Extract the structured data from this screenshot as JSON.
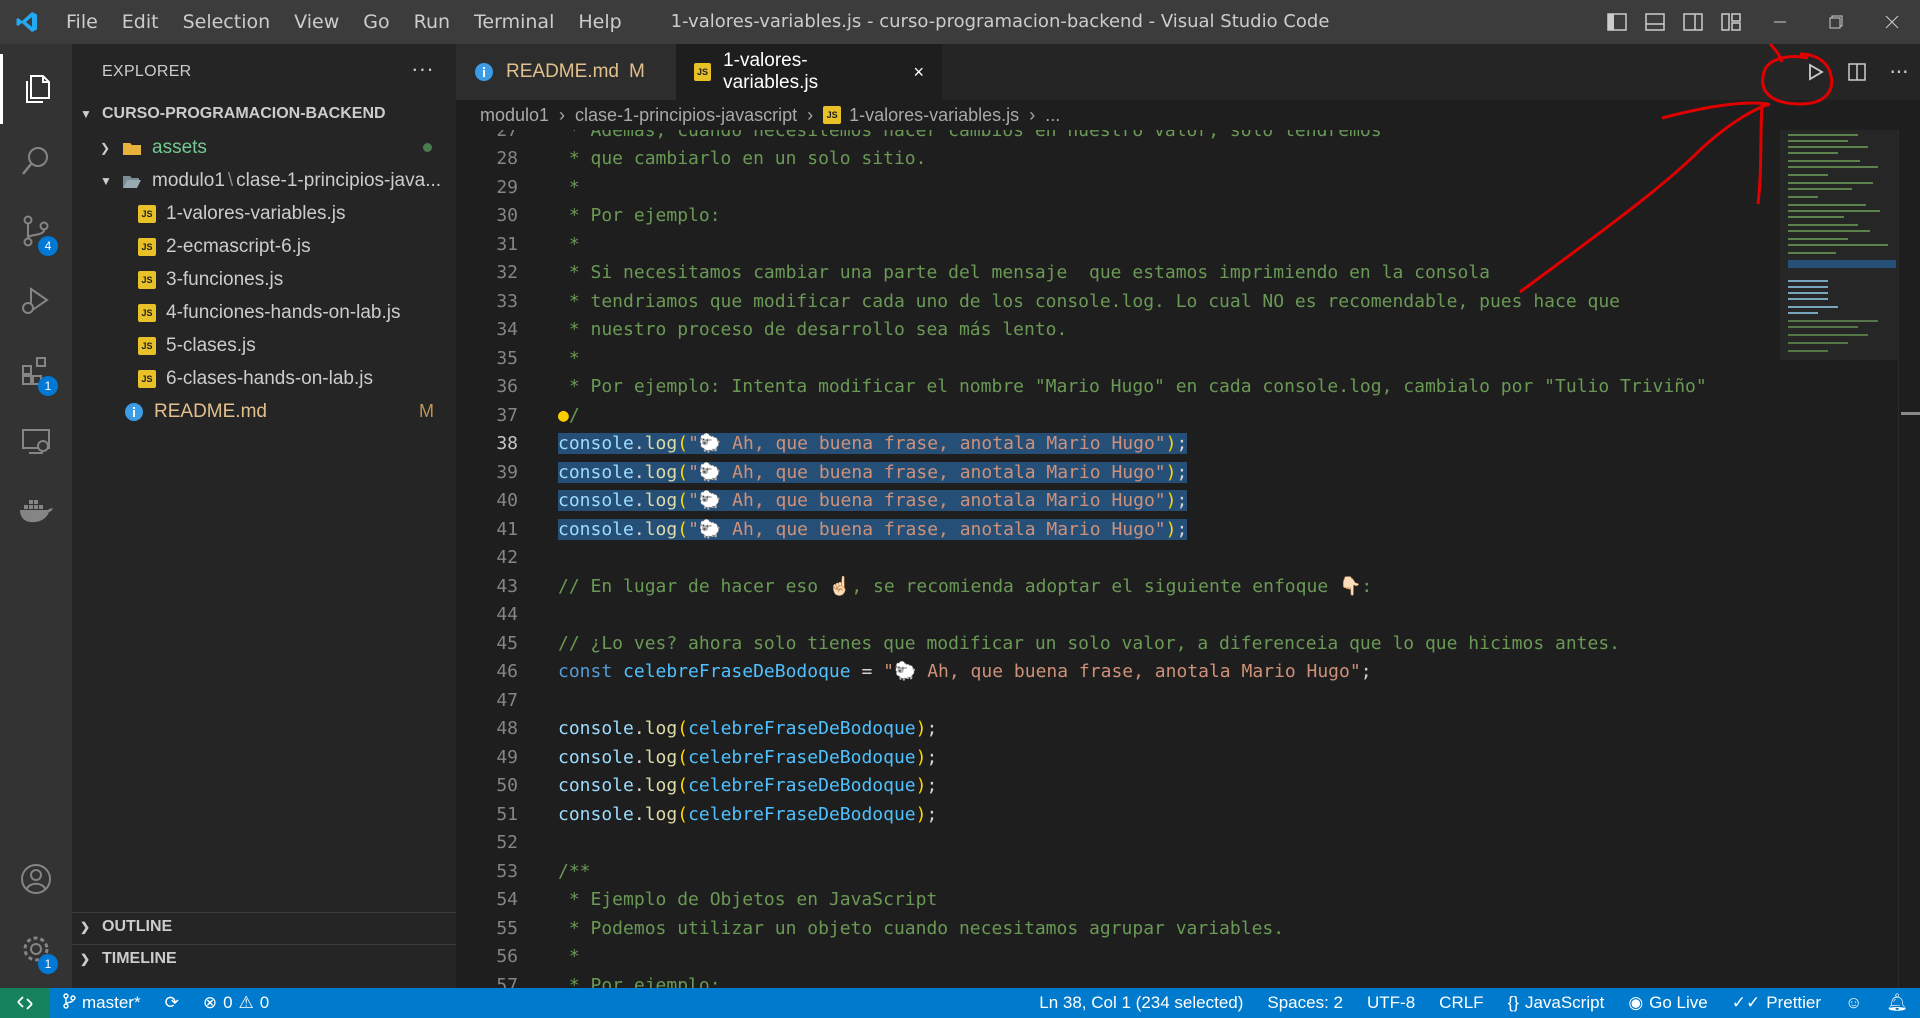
{
  "titlebar": {
    "menu": [
      "File",
      "Edit",
      "Selection",
      "View",
      "Go",
      "Run",
      "Terminal",
      "Help"
    ],
    "title": "1-valores-variables.js - curso-programacion-backend - Visual Studio Code"
  },
  "activitybar": {
    "items": [
      "explorer-icon",
      "search-icon",
      "source-control-icon",
      "run-debug-icon",
      "extensions-icon",
      "remote-explorer-icon",
      "docker-icon",
      "accounts-icon",
      "settings-gear-icon"
    ],
    "source_control_badge": "4",
    "extensions_badge": "1",
    "settings_badge": "1"
  },
  "sidebar": {
    "title": "EXPLORER",
    "more": "···",
    "root": "CURSO-PROGRAMACION-BACKEND",
    "items": [
      {
        "label": "assets"
      },
      {
        "label": "modulo1",
        "sep": "\\",
        "label2": "clase-1-principios-java..."
      },
      {
        "label": "1-valores-variables.js"
      },
      {
        "label": "2-ecmascript-6.js"
      },
      {
        "label": "3-funciones.js"
      },
      {
        "label": "4-funciones-hands-on-lab.js"
      },
      {
        "label": "5-clases.js"
      },
      {
        "label": "6-clases-hands-on-lab.js"
      },
      {
        "label": "README.md",
        "status": "M"
      }
    ],
    "outline": "OUTLINE",
    "timeline": "TIMELINE"
  },
  "tabs": [
    {
      "label": "README.md",
      "status": "M"
    },
    {
      "label": "1-valores-variables.js",
      "close": "×"
    }
  ],
  "breadcrumb": {
    "parts": [
      "modulo1",
      "clase-1-principios-javascript",
      "1-valores-variables.js"
    ],
    "ellipsis": "..."
  },
  "code": {
    "partial_top": " * Además, cuando necesitemos hacer cambios en nuestro valor, solo tendremos",
    "lines": {
      "28": " * que cambiarlo en un solo sitio.",
      "29": " *",
      "30": " * Por ejemplo:",
      "31": " *",
      "32": " * Si necesitamos cambiar una parte del mensaje  que estamos imprimiendo en la consola",
      "33": " * tendriamos que modificar cada uno de los console.log. Lo cual NO es recomendable, pues hace que",
      "34": " * nuestro proceso de desarrollo sea más lento.",
      "35": " *",
      "36": " * Por ejemplo: Intenta modificar el nombre \"Mario Hugo\" en cada console.log, cambialo por \"Tulio Triviño\"",
      "37": "/",
      "43": "// En lugar de hacer eso ☝🏻, se recomienda adoptar el siguiente enfoque 👇🏻:",
      "45": "// ¿Lo ves? ahora solo tienes que modificar un solo valor, a diferenceia que lo que hicimos antes.",
      "53": "/**",
      "54": " * Ejemplo de Objetos en JavaScript",
      "55": " * Podemos utilizar un objeto cuando necesitamos agrupar variables.",
      "56": " *",
      "57": " * Por ejemplo:"
    },
    "log_string": "\"🐑 Ah, que buena frase, anotala Mario Hugo\"",
    "console": "console",
    "log": "log",
    "const_kw": "const",
    "var_name": "celebreFraseDeBodoque"
  },
  "statusbar": {
    "branch": "master*",
    "errors": "0",
    "warnings": "0",
    "position": "Ln 38, Col 1 (234 selected)",
    "spaces": "Spaces: 2",
    "encoding": "UTF-8",
    "eol": "CRLF",
    "language": "JavaScript",
    "golive": "Go Live",
    "prettier": "Prettier"
  },
  "colors": {
    "accent": "#007acc",
    "annotation": "#e00000",
    "selection": "#264f78"
  }
}
